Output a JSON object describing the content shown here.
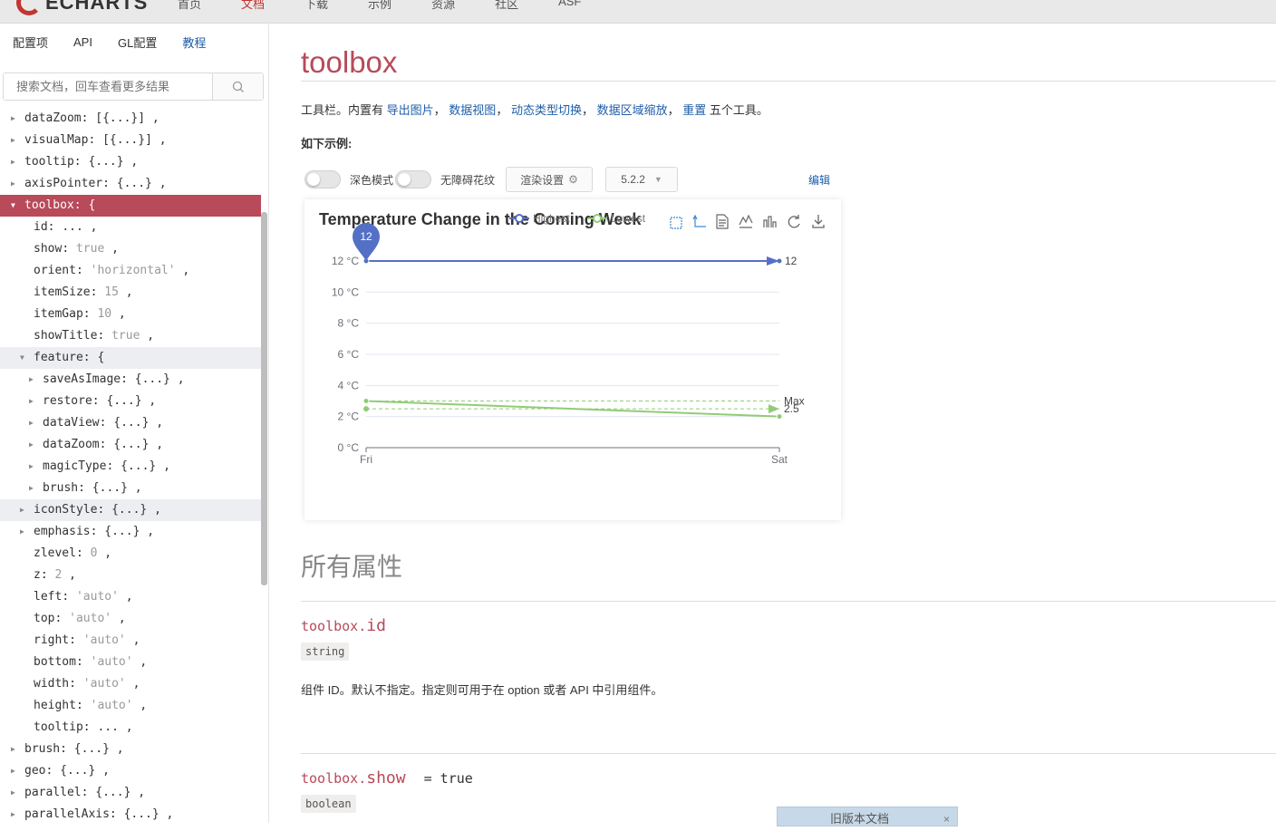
{
  "nav": {
    "logo_text": "ECHARTS",
    "items": [
      "首页",
      "文档",
      "下载",
      "示例",
      "资源",
      "社区",
      "ASF"
    ]
  },
  "sidebar": {
    "tabs": [
      "配置项",
      "API",
      "GL配置",
      "教程"
    ],
    "search_placeholder": "搜索文档，回车查看更多结果",
    "tree": [
      {
        "key": "dataZoom",
        "value": "[{...}]",
        "caret": "right",
        "level": 0
      },
      {
        "key": "visualMap",
        "value": "[{...}]",
        "caret": "right",
        "level": 0
      },
      {
        "key": "tooltip",
        "value": "{...}",
        "caret": "right",
        "level": 0
      },
      {
        "key": "axisPointer",
        "value": "{...}",
        "caret": "right",
        "level": 0
      },
      {
        "key": "toolbox",
        "value": "{",
        "caret": "down",
        "level": 0,
        "selected": true
      },
      {
        "key": "id",
        "value": "...",
        "level": 1
      },
      {
        "key": "show",
        "value": "true",
        "level": 1
      },
      {
        "key": "orient",
        "value": "'horizontal'",
        "level": 1
      },
      {
        "key": "itemSize",
        "value": "15",
        "level": 1
      },
      {
        "key": "itemGap",
        "value": "10",
        "level": 1
      },
      {
        "key": "showTitle",
        "value": "true",
        "level": 1
      },
      {
        "key": "feature",
        "value": "{",
        "caret": "down",
        "level": 1,
        "hover": true
      },
      {
        "key": "saveAsImage",
        "value": "{...}",
        "caret": "right",
        "level": 2
      },
      {
        "key": "restore",
        "value": "{...}",
        "caret": "right",
        "level": 2
      },
      {
        "key": "dataView",
        "value": "{...}",
        "caret": "right",
        "level": 2
      },
      {
        "key": "dataZoom",
        "value": "{...}",
        "caret": "right",
        "level": 2
      },
      {
        "key": "magicType",
        "value": "{...}",
        "caret": "right",
        "level": 2
      },
      {
        "key": "brush",
        "value": "{...}",
        "caret": "right",
        "level": 2
      },
      {
        "key": "iconStyle",
        "value": "{...}",
        "caret": "right",
        "level": 1,
        "hover": true
      },
      {
        "key": "emphasis",
        "value": "{...}",
        "caret": "right",
        "level": 1
      },
      {
        "key": "zlevel",
        "value": "0",
        "level": 1
      },
      {
        "key": "z",
        "value": "2",
        "level": 1
      },
      {
        "key": "left",
        "value": "'auto'",
        "level": 1
      },
      {
        "key": "top",
        "value": "'auto'",
        "level": 1
      },
      {
        "key": "right",
        "value": "'auto'",
        "level": 1
      },
      {
        "key": "bottom",
        "value": "'auto'",
        "level": 1
      },
      {
        "key": "width",
        "value": "'auto'",
        "level": 1
      },
      {
        "key": "height",
        "value": "'auto'",
        "level": 1
      },
      {
        "key": "tooltip",
        "value": "...",
        "level": 1
      },
      {
        "key": "brush",
        "value": "{...}",
        "caret": "right",
        "level": 0
      },
      {
        "key": "geo",
        "value": "{...}",
        "caret": "right",
        "level": 0
      },
      {
        "key": "parallel",
        "value": "{...}",
        "caret": "right",
        "level": 0
      },
      {
        "key": "parallelAxis",
        "value": "{...}",
        "caret": "right",
        "level": 0
      }
    ]
  },
  "main": {
    "title": "toolbox",
    "desc_prefix": "工具栏。内置有",
    "desc_links": [
      "导出图片",
      "数据视图",
      "动态类型切换",
      "数据区域缩放",
      "重置"
    ],
    "desc_suffix": "五个工具。",
    "example_label": "如下示例:",
    "dark_mode_label": "深色模式",
    "decal_label": "无障碍花纹",
    "render_settings_label": "渲染设置",
    "version": "5.2.2",
    "edit_label": "编辑",
    "all_props_title": "所有属性",
    "props": [
      {
        "prefix": "toolbox.",
        "name": "id",
        "default": "",
        "type": "string"
      },
      {
        "prefix": "toolbox.",
        "name": "show",
        "default": "= true",
        "type": "boolean"
      }
    ],
    "id_desc": "组件 ID。默认不指定。指定则可用于在 option 或者 API 中引用组件。",
    "old_doc_label": "旧版本文档",
    "old_doc_close": "×"
  },
  "colors": {
    "accent": "#b84a5a",
    "link": "#1f5ea8",
    "series_high": "#5470c6",
    "series_low": "#91cc75"
  },
  "chart_data": {
    "type": "line",
    "title": "Temperature Change in the Coming Week",
    "legend": [
      "Highest",
      "Lowest"
    ],
    "categories": [
      "Fri",
      "Sat"
    ],
    "yticks": [
      "0 °C",
      "2 °C",
      "4 °C",
      "6 °C",
      "8 °C",
      "10 °C",
      "12 °C"
    ],
    "ylim": [
      0,
      12
    ],
    "series": [
      {
        "name": "Highest",
        "values": [
          12,
          12
        ],
        "color": "#5470c6",
        "mark_point": "12",
        "mark_line": "12"
      },
      {
        "name": "Lowest",
        "values": [
          3,
          2
        ],
        "color": "#91cc75",
        "mark_line_label": "Max",
        "avg_label": "2.5",
        "avg": 2.5
      }
    ],
    "toolbox_icons": [
      "zoom-icon",
      "zoom-reset-icon",
      "data-view-icon",
      "line-icon",
      "bar-icon",
      "restore-icon",
      "save-icon"
    ]
  }
}
